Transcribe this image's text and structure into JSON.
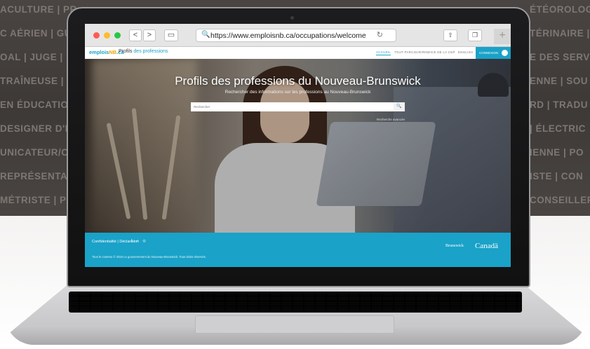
{
  "background": {
    "left_words": [
      "ACULTURE | PR",
      "C AÉRIEN | GU",
      "OAL | JUGE | I",
      "TRAÎNEUSE | C",
      "EN ÉDUCATIO",
      "DESIGNER D'I",
      "UNICATEUR/C",
      "REPRÉSENTAN",
      "MÉTRISTE | P"
    ],
    "right_words": [
      "ÉTÉOROLOGU",
      "TÉRINAIRE |",
      "E DES SERVI",
      "ENNE | SOU",
      "RD | TRADU",
      "| ÉLECTRIC",
      "IENNE | PO",
      "ISTE | CON",
      "CONSEILLER/"
    ]
  },
  "browser": {
    "url": "https://www.emploisnb.ca/occupations/welcome",
    "back_label": "<",
    "forward_label": ">"
  },
  "site": {
    "logo_main": "emplois",
    "logo_accent": "NB",
    "logo_suffix": ".ca",
    "title_prefix": "Profils",
    "title_accent": "des professions",
    "nav": [
      "ACCUEIL",
      "TOUT PARCOURIR",
      "INDICE DE LA CNP",
      "ENGLISH"
    ],
    "connect_label": "CONNEXION"
  },
  "hero": {
    "title": "Profils des professions du Nouveau-Brunswick",
    "subtitle": "Rechercher des informations sur les professions au Nouveau-Brunswick",
    "search_placeholder": "Rechercher",
    "search_button": "🔍",
    "advanced_link": "Recherche avancée"
  },
  "footer": {
    "links": "Confidentialité | Déclaration",
    "social": "f ✓ ◎",
    "copyright": "Tous le contenu © 2016 Le gouvernement du Nouveau-Brunswick. Tous droits réservés.",
    "nb_logo": "Brunswick",
    "canada_logo": "Canadä"
  },
  "colors": {
    "accent": "#1aa2c8",
    "connect": "#1aa2c8"
  }
}
